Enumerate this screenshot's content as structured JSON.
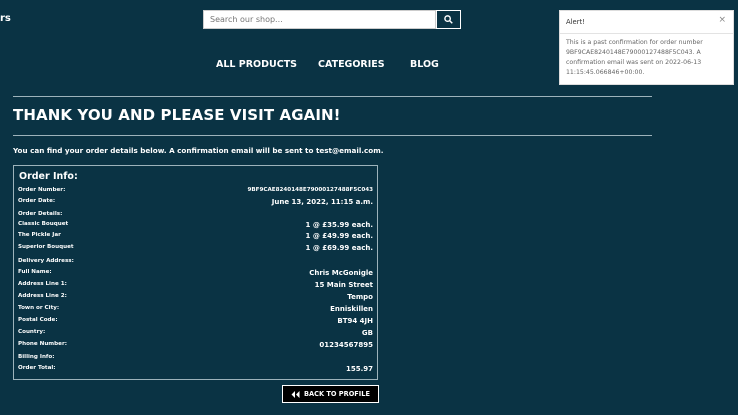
{
  "header": {
    "brand_fragment": "rs",
    "search": {
      "placeholder": "Search our shop..."
    }
  },
  "nav": {
    "items": [
      "ALL PRODUCTS",
      "CATEGORIES",
      "BLOG"
    ]
  },
  "page": {
    "title": "THANK YOU AND PLEASE VISIT AGAIN!",
    "intro_prefix": "You can find your order details below. A confirmation email will be sent to ",
    "intro_email": "test@email.com",
    "intro_suffix": "."
  },
  "order_info": {
    "heading": "Order Info:",
    "rows": [
      {
        "label": "Order Number:",
        "value": "9BF9CAE8240148E79000127488F5C043"
      },
      {
        "label": "Order Date:",
        "value": "June 13, 2022, 11:15 a.m."
      },
      {
        "label": "Order Details:",
        "value": ""
      },
      {
        "label": "Classic Bouquet",
        "value": "1 @ £35.99 each."
      },
      {
        "label": "The Pickle Jar",
        "value": "1 @ £49.99 each."
      },
      {
        "label": "Superior Bouquet",
        "value": "1 @ £69.99 each."
      },
      {
        "label": "Delivery Address:",
        "value": ""
      },
      {
        "label": "Full Name:",
        "value": "Chris McGonigle"
      },
      {
        "label": "Address Line 1:",
        "value": "15 Main Street"
      },
      {
        "label": "Address Line 2:",
        "value": "Tempo"
      },
      {
        "label": "Town or City:",
        "value": "Enniskillen"
      },
      {
        "label": "Postal Code:",
        "value": "BT94 4JH"
      },
      {
        "label": "Country:",
        "value": "GB"
      },
      {
        "label": "Phone Number:",
        "value": "01234567895"
      },
      {
        "label": "Billing Info:",
        "value": ""
      },
      {
        "label": "Order Total:",
        "value": "155.97"
      }
    ]
  },
  "back_button": {
    "label": "BACK TO PROFILE"
  },
  "alert": {
    "title": "Alert!",
    "close_glyph": "×",
    "message": "This is a past confirmation for order number 9BF9CAE8240148E79000127488F5C043. A confirmation email was sent on 2022-06-13 11:15:45.066846+00:00."
  },
  "colors": {
    "background": "#0a3344",
    "rule": "#9db3bb",
    "button": "#000000"
  }
}
